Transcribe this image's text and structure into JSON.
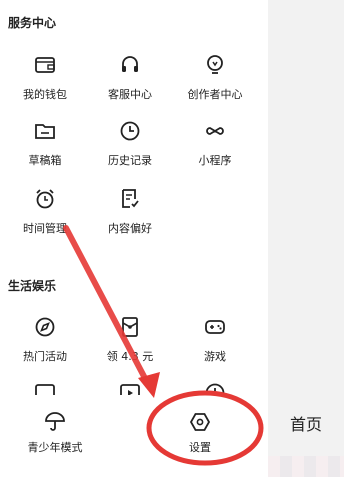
{
  "sections": [
    {
      "title": "服务中心",
      "items": [
        {
          "label": "我的钱包",
          "icon": "wallet-icon"
        },
        {
          "label": "客服中心",
          "icon": "headset-icon"
        },
        {
          "label": "创作者中心",
          "icon": "lightbulb-icon"
        },
        {
          "label": "草稿箱",
          "icon": "folder-icon"
        },
        {
          "label": "历史记录",
          "icon": "clock-icon"
        },
        {
          "label": "小程序",
          "icon": "mini-program-icon"
        },
        {
          "label": "时间管理",
          "icon": "alarm-clock-icon"
        },
        {
          "label": "内容偏好",
          "icon": "preference-doc-icon"
        }
      ]
    },
    {
      "title": "生活娱乐",
      "items": [
        {
          "label": "热门活动",
          "icon": "compass-icon"
        },
        {
          "label": "领 4.3 元",
          "icon": "red-packet-icon"
        },
        {
          "label": "游戏",
          "icon": "gamepad-icon"
        }
      ]
    }
  ],
  "bottom": {
    "teen_mode": {
      "label": "青少年模式",
      "icon": "umbrella-icon"
    },
    "settings": {
      "label": "设置",
      "icon": "hexagon-settings-icon"
    }
  },
  "side_tab": {
    "label": "首页"
  },
  "annotation_color": "#e53935"
}
